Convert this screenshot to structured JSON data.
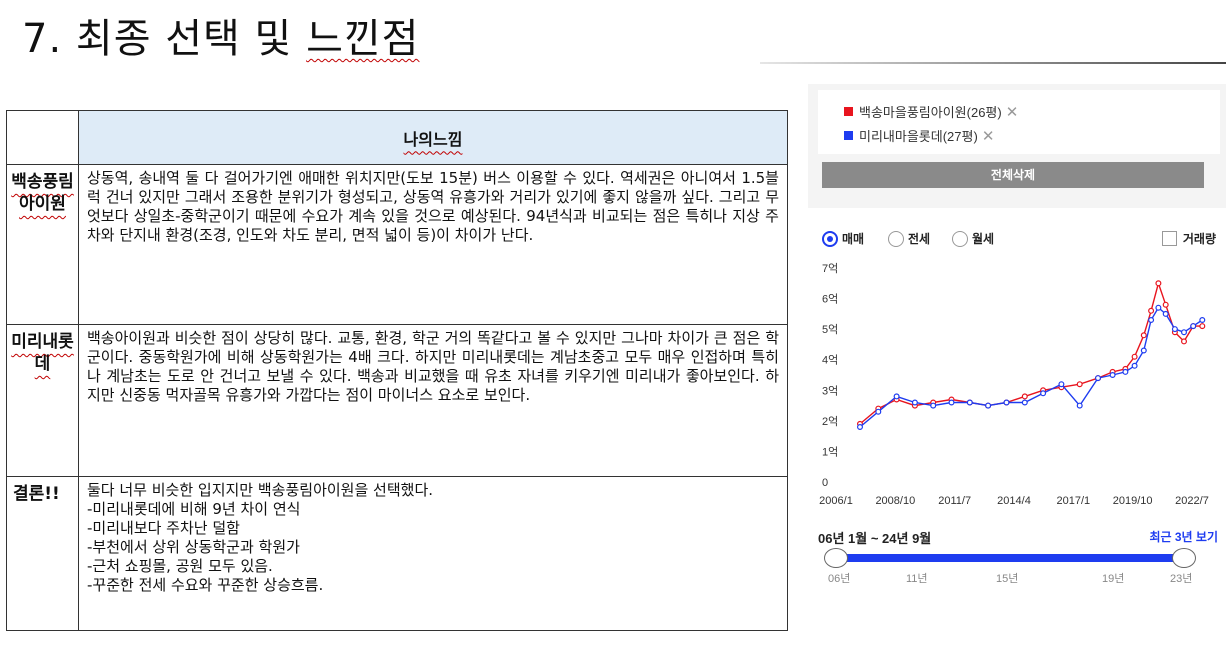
{
  "slide": {
    "title_prefix": "7.",
    "title_words": [
      "최종",
      "선택",
      "및",
      "느낀점"
    ]
  },
  "table": {
    "header": "나의느낌",
    "rows": [
      {
        "label": "백송풍림아이원",
        "text": "상동역, 송내역 둘 다 걸어가기엔 애매한 위치지만(도보 15분) 버스 이용할 수 있다. 역세권은 아니여서 1.5블럭 건너 있지만 그래서 조용한 분위기가 형성되고, 상동역 유흥가와 거리가 있기에 좋지 않을까 싶다. 그리고 무엇보다 상일초-중학군이기 때문에 수요가 계속 있을 것으로 예상된다. 94년식과 비교되는 점은 특히나 지상 주차와 단지내 환경(조경, 인도와 차도 분리, 면적 넓이 등)이 차이가 난다."
      },
      {
        "label": "미리내롯데",
        "text": "백송아이원과 비슷한 점이 상당히 많다. 교통, 환경, 학군 거의 똑같다고 볼 수 있지만 그나마 차이가 큰 점은 학군이다. 중동학원가에 비해 상동학원가는 4배 크다. 하지만 미리내롯데는 계남초중고 모두 매우 인접하며 특히나 계남초는 도로 안 건너고 보낼 수 있다. 백송과 비교했을 때 유초 자녀를 키우기엔 미리내가 좋아보인다. 하지만 신중동 먹자골목 유흥가와 가깝다는 점이 마이너스 요소로 보인다."
      },
      {
        "label": "결론!!",
        "lines": [
          "둘다 너무 비슷한 입지지만 백송풍림아이원을 선택했다.",
          "-미리내롯데에 비해 9년 차이 연식",
          "-미리내보다 주차난 덜함",
          "-부천에서 상위 상동학군과 학원가",
          "-근처 쇼핑몰, 공원 모두 있음.",
          "-꾸준한 전세 수요와 꾸준한 상승흐름."
        ]
      }
    ]
  },
  "panel": {
    "legend": [
      {
        "label": "백송마을풍림아이원(26평)",
        "color": "#e8141e",
        "remove": "✕"
      },
      {
        "label": "미리내마을롯데(27평)",
        "color": "#1e3cf0",
        "remove": "✕"
      }
    ],
    "delete_all": "전체삭제",
    "radios": [
      {
        "label": "매매",
        "selected": true
      },
      {
        "label": "전세",
        "selected": false
      },
      {
        "label": "월세",
        "selected": false
      }
    ],
    "volume_checkbox": "거래량",
    "range_label": "06년 1월 ~ 24년 9월",
    "recent_link": "최근 3년 보기",
    "slider_ticks": [
      "06년",
      "11년",
      "15년",
      "19년",
      "23년"
    ]
  },
  "chart_data": {
    "type": "line",
    "y_tick_labels": [
      "0",
      "1억",
      "2억",
      "3억",
      "4억",
      "5억",
      "6억",
      "7억"
    ],
    "ylim": [
      0,
      7
    ],
    "x_tick_labels": [
      "2006/1",
      "2008/10",
      "2011/7",
      "2014/4",
      "2017/1",
      "2019/10",
      "2022/7"
    ],
    "x": [
      2006.0,
      2007.0,
      2008.0,
      2009.0,
      2010.0,
      2011.0,
      2012.0,
      2013.0,
      2014.0,
      2015.0,
      2016.0,
      2017.0,
      2018.0,
      2019.0,
      2019.8,
      2020.5,
      2021.0,
      2021.5,
      2021.9,
      2022.3,
      2022.7,
      2023.2,
      2023.7,
      2024.2,
      2024.7
    ],
    "series": [
      {
        "name": "백송마을풍림아이원(26평)",
        "color": "#e8141e",
        "values": [
          1.9,
          2.4,
          2.7,
          2.5,
          2.6,
          2.7,
          2.6,
          2.5,
          2.6,
          2.8,
          3.0,
          3.1,
          3.2,
          3.4,
          3.6,
          3.7,
          4.1,
          4.8,
          5.6,
          6.5,
          5.8,
          4.9,
          4.6,
          5.1,
          5.1
        ]
      },
      {
        "name": "미리내마을롯데(27평)",
        "color": "#1e3cf0",
        "values": [
          1.8,
          2.3,
          2.8,
          2.6,
          2.5,
          2.6,
          2.6,
          2.5,
          2.6,
          2.6,
          2.9,
          3.2,
          2.5,
          3.4,
          3.5,
          3.6,
          3.8,
          4.3,
          5.3,
          5.7,
          5.5,
          5.0,
          4.9,
          5.1,
          5.3
        ]
      }
    ]
  }
}
